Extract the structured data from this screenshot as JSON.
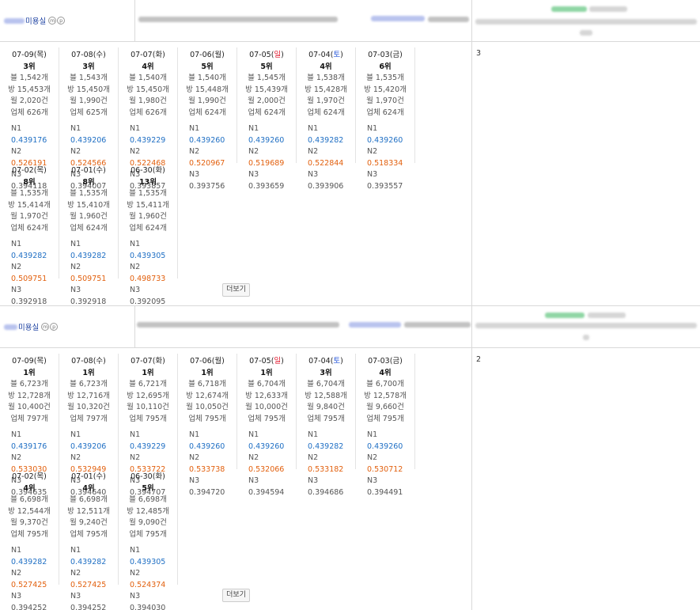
{
  "listings": [
    {
      "shop_label": "미용실",
      "badges": [
        "m",
        "p"
      ],
      "count": "3",
      "more_label": "더보기",
      "cards": [
        {
          "date": "07-09",
          "day": "목",
          "day_type": "wk",
          "rank": "3위",
          "blog": "블 1,542개",
          "bang": "방 15,453개",
          "month": "월 2,020건",
          "biz": "업체 626개",
          "n1": "0.439176",
          "n2": "0.526191",
          "n3": "0.394118"
        },
        {
          "date": "07-08",
          "day": "수",
          "day_type": "wk",
          "rank": "3위",
          "blog": "블 1,543개",
          "bang": "방 15,450개",
          "month": "월 1,990건",
          "biz": "업체 625개",
          "n1": "0.439206",
          "n2": "0.524566",
          "n3": "0.394007"
        },
        {
          "date": "07-07",
          "day": "화",
          "day_type": "wk",
          "rank": "4위",
          "blog": "블 1,540개",
          "bang": "방 15,450개",
          "month": "월 1,980건",
          "biz": "업체 626개",
          "n1": "0.439229",
          "n2": "0.522468",
          "n3": "0.393857"
        },
        {
          "date": "07-06",
          "day": "월",
          "day_type": "wk",
          "rank": "5위",
          "blog": "블 1,540개",
          "bang": "방 15,448개",
          "month": "월 1,990건",
          "biz": "업체 624개",
          "n1": "0.439260",
          "n2": "0.520967",
          "n3": "0.393756"
        },
        {
          "date": "07-05",
          "day": "일",
          "day_type": "sun",
          "rank": "5위",
          "blog": "블 1,545개",
          "bang": "방 15,439개",
          "month": "월 2,000건",
          "biz": "업체 624개",
          "n1": "0.439260",
          "n2": "0.519689",
          "n3": "0.393659"
        },
        {
          "date": "07-04",
          "day": "토",
          "day_type": "sat",
          "rank": "4위",
          "blog": "블 1,538개",
          "bang": "방 15,428개",
          "month": "월 1,970건",
          "biz": "업체 624개",
          "n1": "0.439282",
          "n2": "0.522844",
          "n3": "0.393906"
        },
        {
          "date": "07-03",
          "day": "금",
          "day_type": "wk",
          "rank": "6위",
          "blog": "블 1,535개",
          "bang": "방 15,420개",
          "month": "월 1,970건",
          "biz": "업체 624개",
          "n1": "0.439260",
          "n2": "0.518334",
          "n3": "0.393557"
        },
        {
          "date": "07-02",
          "day": "목",
          "day_type": "wk",
          "rank": "8위",
          "blog": "블 1,535개",
          "bang": "방 15,414개",
          "month": "월 1,970건",
          "biz": "업체 624개",
          "n1": "0.439282",
          "n2": "0.509751",
          "n3": "0.392918"
        },
        {
          "date": "07-01",
          "day": "수",
          "day_type": "wk",
          "rank": "8위",
          "blog": "블 1,535개",
          "bang": "방 15,410개",
          "month": "월 1,960건",
          "biz": "업체 624개",
          "n1": "0.439282",
          "n2": "0.509751",
          "n3": "0.392918"
        },
        {
          "date": "06-30",
          "day": "화",
          "day_type": "wk",
          "rank": "13위",
          "blog": "블 1,535개",
          "bang": "방 15,411개",
          "month": "월 1,960건",
          "biz": "업체 624개",
          "n1": "0.439305",
          "n2": "0.498733",
          "n3": "0.392095"
        }
      ]
    },
    {
      "shop_label": "미용실",
      "badges": [
        "m",
        "p"
      ],
      "count": "2",
      "more_label": "더보기",
      "cards": [
        {
          "date": "07-09",
          "day": "목",
          "day_type": "wk",
          "rank": "1위",
          "blog": "블 6,723개",
          "bang": "방 12,728개",
          "month": "월 10,400건",
          "biz": "업체 797개",
          "n1": "0.439176",
          "n2": "0.533030",
          "n3": "0.394635"
        },
        {
          "date": "07-08",
          "day": "수",
          "day_type": "wk",
          "rank": "1위",
          "blog": "블 6,723개",
          "bang": "방 12,716개",
          "month": "월 10,320건",
          "biz": "업체 797개",
          "n1": "0.439206",
          "n2": "0.532949",
          "n3": "0.394640"
        },
        {
          "date": "07-07",
          "day": "화",
          "day_type": "wk",
          "rank": "1위",
          "blog": "블 6,721개",
          "bang": "방 12,695개",
          "month": "월 10,110건",
          "biz": "업체 795개",
          "n1": "0.439229",
          "n2": "0.533722",
          "n3": "0.394707"
        },
        {
          "date": "07-06",
          "day": "월",
          "day_type": "wk",
          "rank": "1위",
          "blog": "블 6,718개",
          "bang": "방 12,674개",
          "month": "월 10,050건",
          "biz": "업체 795개",
          "n1": "0.439260",
          "n2": "0.533738",
          "n3": "0.394720"
        },
        {
          "date": "07-05",
          "day": "일",
          "day_type": "sun",
          "rank": "1위",
          "blog": "블 6,704개",
          "bang": "방 12,633개",
          "month": "월 10,000건",
          "biz": "업체 795개",
          "n1": "0.439260",
          "n2": "0.532066",
          "n3": "0.394594"
        },
        {
          "date": "07-04",
          "day": "토",
          "day_type": "sat",
          "rank": "3위",
          "blog": "블 6,704개",
          "bang": "방 12,588개",
          "month": "월 9,840건",
          "biz": "업체 795개",
          "n1": "0.439282",
          "n2": "0.533182",
          "n3": "0.394686"
        },
        {
          "date": "07-03",
          "day": "금",
          "day_type": "wk",
          "rank": "4위",
          "blog": "블 6,700개",
          "bang": "방 12,578개",
          "month": "월 9,660건",
          "biz": "업체 795개",
          "n1": "0.439260",
          "n2": "0.530712",
          "n3": "0.394491"
        },
        {
          "date": "07-02",
          "day": "목",
          "day_type": "wk",
          "rank": "4위",
          "blog": "블 6,698개",
          "bang": "방 12,544개",
          "month": "월 9,370건",
          "biz": "업체 795개",
          "n1": "0.439282",
          "n2": "0.527425",
          "n3": "0.394252"
        },
        {
          "date": "07-01",
          "day": "수",
          "day_type": "wk",
          "rank": "4위",
          "blog": "블 6,698개",
          "bang": "방 12,511개",
          "month": "월 9,240건",
          "biz": "업체 795개",
          "n1": "0.439282",
          "n2": "0.527425",
          "n3": "0.394252"
        },
        {
          "date": "06-30",
          "day": "화",
          "day_type": "wk",
          "rank": "5위",
          "blog": "블 6,698개",
          "bang": "방 12,485개",
          "month": "월 9,090건",
          "biz": "업체 795개",
          "n1": "0.439305",
          "n2": "0.524374",
          "n3": "0.394030"
        }
      ]
    }
  ],
  "colors": {
    "sun": "#e0162b",
    "sat": "#1d4fd8",
    "n1": "#1f6fc4",
    "n2": "#e2600e"
  }
}
